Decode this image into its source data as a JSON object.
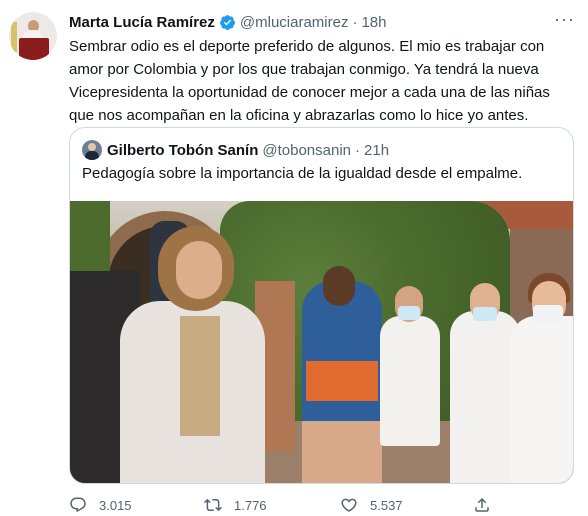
{
  "tweet": {
    "author_name": "Marta Lucía Ramírez",
    "handle": "@mluciaramirez",
    "separator": "·",
    "time": "18h",
    "text": "Sembrar odio es el deporte preferido de algunos. El mio es trabajar con amor por Colombia y por los que trabajan conmigo. Ya tendrá la nueva Vicepresidenta la oportunidad de conocer mejor a cada una de las niñas que nos acompañan en la oficina y abrazarlas como lo hice yo antes.",
    "icons": {
      "verified": "verified-badge-icon",
      "more": "more-icon"
    }
  },
  "quote": {
    "author_name": "Gilberto Tobón Sanín",
    "handle": "@tobonsanin",
    "separator": "·",
    "time": "21h",
    "text": "Pedagogía sobre la importancia de la igualdad desde el empalme."
  },
  "actions": {
    "reply_count": "3.015",
    "retweet_count": "1.776",
    "like_count": "5.537",
    "icons": [
      "reply-icon",
      "retweet-icon",
      "like-icon",
      "share-icon"
    ]
  },
  "colors": {
    "text_primary": "#0f1419",
    "text_secondary": "#536471",
    "verified": "#1d9bf0",
    "border": "#cfd9de"
  }
}
